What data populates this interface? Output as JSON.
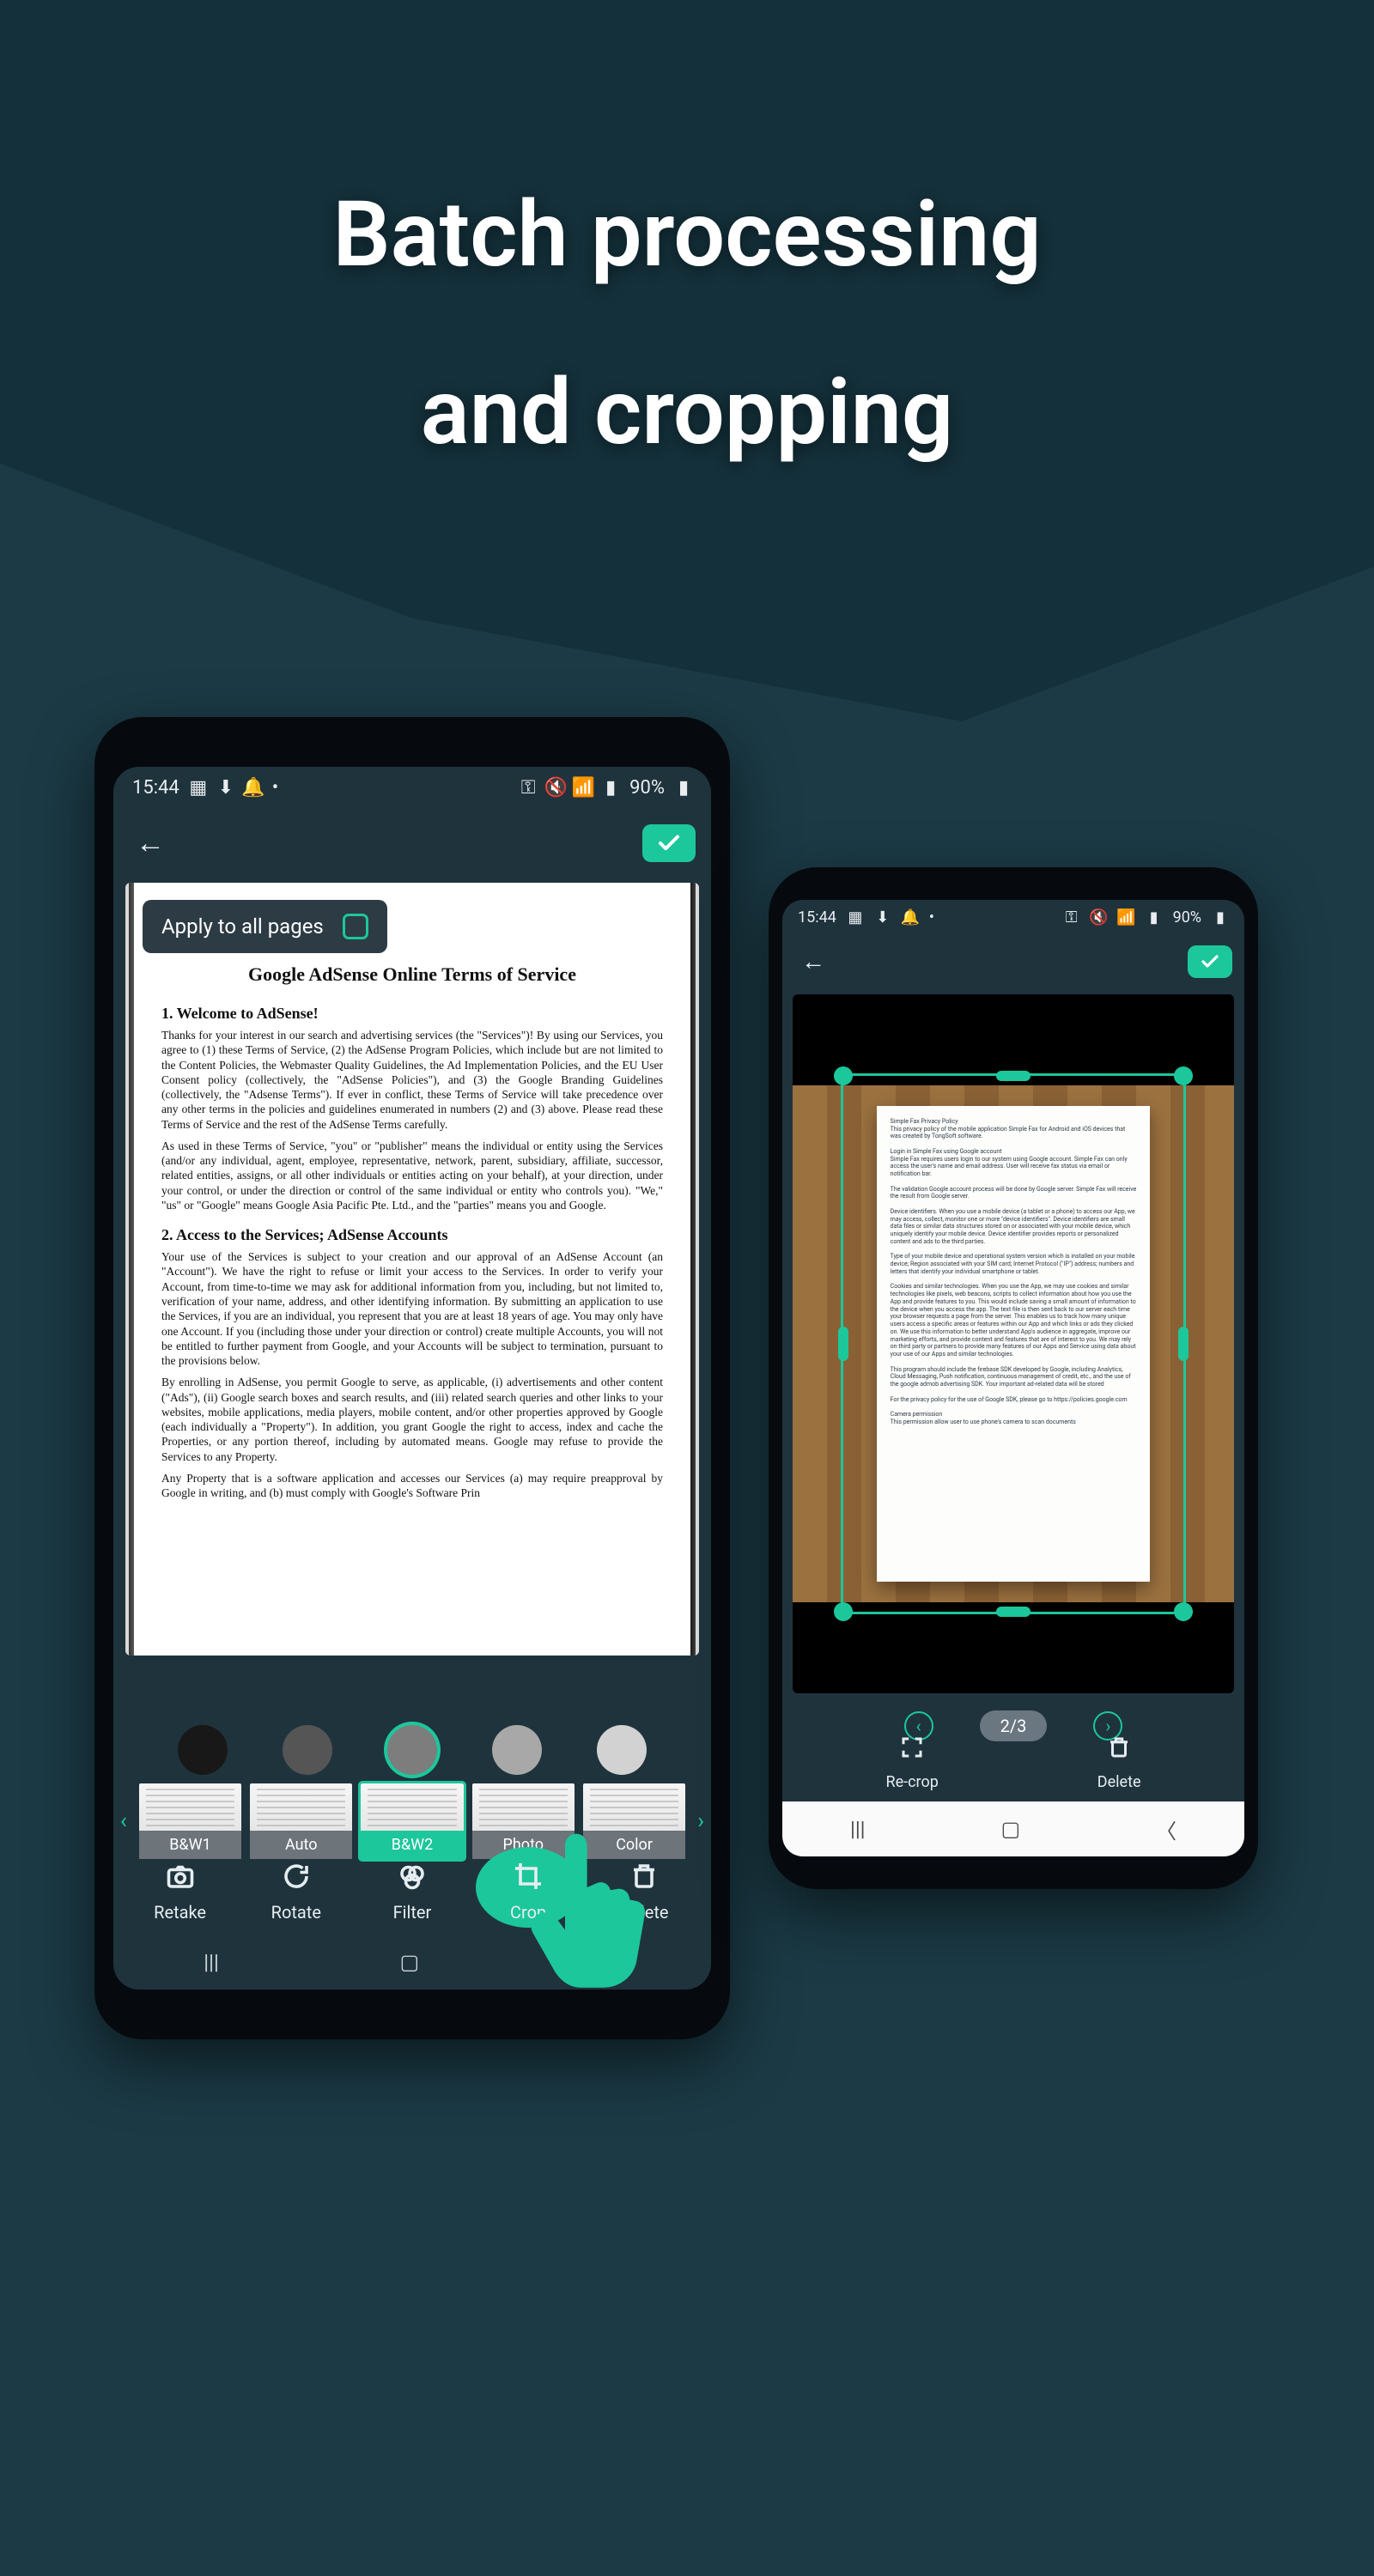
{
  "hero_line1": "Batch processing",
  "hero_line2": "and cropping",
  "status": {
    "time": "15:44",
    "battery": "90%"
  },
  "apply_all_label": "Apply to all pages",
  "doc": {
    "title": "Google AdSense Online Terms of Service",
    "h1": "1.  Welcome to AdSense!",
    "p1": "Thanks for your interest in our search and advertising services (the \"Services\")! By using our Services, you agree to (1) these Terms of Service, (2) the AdSense Program Policies, which include but are not limited to the Content Policies, the Webmaster Quality Guidelines, the Ad Implementation Policies, and the EU User Consent policy (collectively, the \"AdSense Policies\"), and (3) the Google Branding Guidelines (collectively, the \"Adsense Terms\"). If ever in conflict, these Terms of Service will take precedence over any other terms in the policies and guidelines enumerated in numbers (2) and (3) above. Please read these Terms of Service and the rest of the AdSense Terms carefully.",
    "p2": "As used in these Terms of Service, \"you\" or \"publisher\" means the individual or entity using the Services (and/or any individual, agent, employee, representative, network, parent, subsidiary, affiliate, successor, related entities, assigns, or all other individuals or entities acting on your behalf), at your direction, under your control, or under the direction or control of the same individual or entity who controls you). \"We,\" \"us\" or \"Google\" means Google Asia Pacific Pte. Ltd., and the \"parties\" means you and Google.",
    "h2": "2.  Access to the Services; AdSense Accounts",
    "p3": "Your use of the Services is subject to your creation and our approval of an AdSense Account (an \"Account\"). We have the right to refuse or limit your access to the Services. In order to verify your Account, from time-to-time we may ask for additional information from you, including, but not limited to, verification of your name, address, and other identifying information. By submitting an application to use the Services, if you are an individual, you represent that you are at least 18 years of age. You may only have one Account. If you (including those under your direction or control) create multiple Accounts, you will not be entitled to further payment from Google, and your Accounts will be subject to termination, pursuant to the provisions below.",
    "p4": "By enrolling in AdSense, you permit Google to serve, as applicable, (i) advertisements and other content (\"Ads\"), (ii) Google search boxes and search results, and (iii) related search queries and other links to your websites, mobile applications, media players, mobile content, and/or other properties approved by Google (each individually a \"Property\"). In addition, you grant Google the right to access, index and cache the Properties, or any portion thereof, including by automated means. Google may refuse to provide the Services to any Property.",
    "p5": "Any Property that is a software application and accesses our Services (a) may require preapproval by Google in writing, and (b) must comply with Google's Software Prin"
  },
  "tones": [
    "#181818",
    "#555555",
    "#7d7d7d",
    "#a8a8a8",
    "#d2d2d2"
  ],
  "tone_selected_index": 2,
  "filters": [
    {
      "label": "B&W1"
    },
    {
      "label": "Auto"
    },
    {
      "label": "B&W2",
      "selected": true
    },
    {
      "label": "Photo"
    },
    {
      "label": "Color"
    }
  ],
  "tools_a": {
    "retake": "Retake",
    "rotate": "Rotate",
    "filter": "Filter",
    "crop": "Crop",
    "delete": "Delete"
  },
  "pager": {
    "label": "2/3"
  },
  "tools_b": {
    "recrop": "Re-crop",
    "delete": "Delete"
  },
  "paper_b_text": "Simple Fax Privacy Policy\nThis privacy policy of the mobile application Simple Fax for Android and iOS devices that was created by TongSoft software.\n\nLogin in Simple Fax using Google account\nSimple Fax requires users login to our system using Google account. Simple Fax can only access the user's name and email address. User will receive fax status via email or notification bar.\n\nThe validation Google account process will be done by Google server. Simple Fax will receive the result from Google server.\n\nDevice identifiers. When you use a mobile device (a tablet or a phone) to access our App, we may access, collect, monitor one or more \"device identifiers\". Device identifiers are small data files or similar data structures stored on or associated with your mobile device, which uniquely identify your mobile device. Device identifier provides reports or personalized content and ads to the third parties.\n\nType of your mobile device and operational system version which is installed on your mobile device; Region associated with your SIM card; Internet Protocol (\"IP\") address; numbers and letters that identify your individual smartphone or tablet.\n\nCookies and similar technologies. When you use the App, we may use cookies and similar technologies like pixels, web beacons, scripts to collect information about how you use the App and provide features to you. This would include saving a small amount of information to the device when you access the app. The text file is then sent back to our server each time your browser requests a page from the server. This enables us to track how many unique users access a specific areas or features within our App and which links or ads they clicked on. We use this information to better understand App's audience in aggregate, improve our marketing efforts, and provide content and features that are of interest to you. We may rely on third party or partners to provide many features of our Apps and Service using data about your use of our Apps and similar technologies.\n\nThis program should include the firebase SDK developed by Google, including Analytics, Cloud Messaging, Push notification, continuous management of credit, etc., and the use of the google admob advertising SDK. Your important ad-related data will be stored\n\nFor the privacy policy for the use of Google SDK, please go to https://policies.google.com\n\nCamera permission\nThis permission allow user to use phone's camera to scan documents"
}
